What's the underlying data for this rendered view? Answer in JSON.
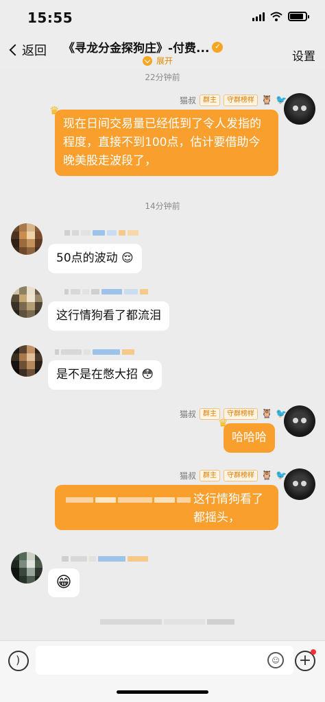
{
  "status_bar": {
    "time": "15:55"
  },
  "nav": {
    "back_label": "返回",
    "title": "《寻龙分金探狗庄》-付费...",
    "expand_label": "展开",
    "settings_label": "设置"
  },
  "timestamps": [
    "22分钟前",
    "14分钟前"
  ],
  "messages": [
    {
      "sender": "猫叔",
      "tags": [
        "群主",
        "守群榜样"
      ],
      "text": "现在日间交易量已经低到了令人发指的程度，直接不到100点，估计要借助今晚美股走波段了，",
      "side": "right"
    },
    {
      "text": "50点的波动 😌",
      "side": "left"
    },
    {
      "text": "这行情狗看了都流泪",
      "side": "left"
    },
    {
      "text": "是不是在憋大招 😳",
      "side": "left"
    },
    {
      "sender": "猫叔",
      "tags": [
        "群主",
        "守群榜样"
      ],
      "text": "哈哈哈",
      "side": "right"
    },
    {
      "sender": "猫叔",
      "tags": [
        "群主",
        "守群榜样"
      ],
      "text_tail": "这行情狗看了都摇头，",
      "side": "right"
    },
    {
      "text": "😁",
      "side": "left"
    }
  ],
  "input": {
    "placeholder": ""
  },
  "colors": {
    "bubble_accent": "#f99f2e",
    "background": "#ececec"
  },
  "icons": [
    "signal-icon",
    "wifi-icon",
    "battery-icon",
    "voice-icon",
    "emoji-icon",
    "plus-icon",
    "crown-icon"
  ]
}
